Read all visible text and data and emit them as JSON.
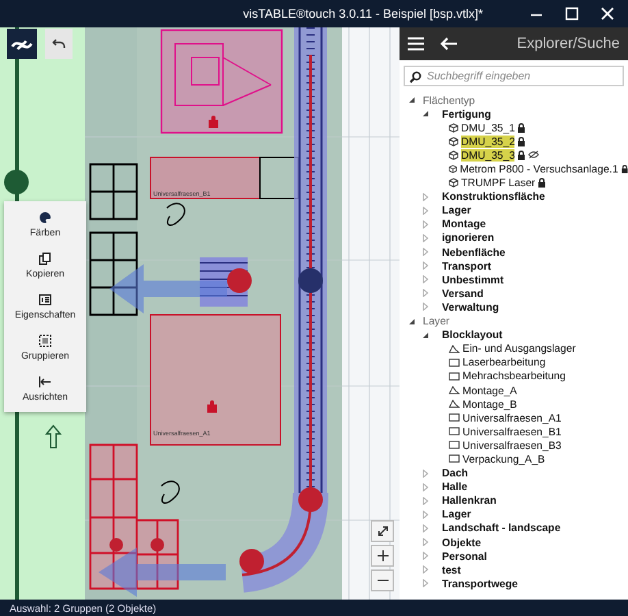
{
  "window": {
    "title": "visTABLE®touch  3.0.11 - Beispiel [bsp.vtlx]*"
  },
  "canvas": {
    "labels": [
      {
        "text": "Universalfraesen_B1"
      },
      {
        "text": "Universalfraesen_A1"
      }
    ]
  },
  "context_menu": {
    "items": [
      {
        "label": "Färben",
        "kind": "palette"
      },
      {
        "label": "Kopieren",
        "kind": "copy"
      },
      {
        "label": "Eigenschaften",
        "kind": "properties"
      },
      {
        "label": "Gruppieren",
        "kind": "group"
      },
      {
        "label": "Ausrichten",
        "kind": "align"
      }
    ]
  },
  "explorer": {
    "title": "Explorer/Suche",
    "search": {
      "placeholder": "Suchbegriff eingeben"
    },
    "tree": [
      {
        "label": "Flächentyp",
        "expanded": true,
        "children": [
          {
            "label": "Fertigung",
            "expanded": true,
            "children": [
              {
                "label": "DMU_35_1",
                "kind": "cube",
                "locked": true,
                "hidden": false,
                "highlighted": false
              },
              {
                "label": "DMU_35_2",
                "kind": "cube",
                "locked": true,
                "hidden": false,
                "highlighted": true
              },
              {
                "label": "DMU_35_3",
                "kind": "cube",
                "locked": true,
                "hidden": true,
                "highlighted": true
              },
              {
                "label": "Metrom P800 - Versuchsanlage.1",
                "kind": "cube",
                "locked": true,
                "hidden": false,
                "highlighted": false
              },
              {
                "label": "TRUMPF Laser",
                "kind": "cube",
                "locked": true,
                "hidden": false,
                "highlighted": false
              }
            ]
          },
          {
            "label": "Konstruktionsfläche",
            "expanded": false
          },
          {
            "label": "Lager",
            "expanded": false
          },
          {
            "label": "Montage",
            "expanded": false
          },
          {
            "label": "ignorieren",
            "expanded": false
          },
          {
            "label": "Nebenfläche",
            "expanded": false
          },
          {
            "label": "Transport",
            "expanded": false
          },
          {
            "label": "Unbestimmt",
            "expanded": false
          },
          {
            "label": "Versand",
            "expanded": false
          },
          {
            "label": "Verwaltung",
            "expanded": false
          }
        ]
      },
      {
        "label": "Layer",
        "expanded": true,
        "children": [
          {
            "label": "Blocklayout",
            "expanded": true,
            "children": [
              {
                "label": "Ein- und Ausgangslager",
                "kind": "poly",
                "locked": false,
                "hidden": false,
                "highlighted": false
              },
              {
                "label": "Laserbearbeitung",
                "kind": "rect",
                "locked": false,
                "hidden": false,
                "highlighted": false
              },
              {
                "label": "Mehrachsbearbeitung",
                "kind": "rect",
                "locked": false,
                "hidden": false,
                "highlighted": false
              },
              {
                "label": "Montage_A",
                "kind": "poly",
                "locked": false,
                "hidden": false,
                "highlighted": false
              },
              {
                "label": "Montage_B",
                "kind": "poly",
                "locked": false,
                "hidden": false,
                "highlighted": false
              },
              {
                "label": "Universalfraesen_A1",
                "kind": "rect",
                "locked": false,
                "hidden": false,
                "highlighted": false
              },
              {
                "label": "Universalfraesen_B1",
                "kind": "rect",
                "locked": false,
                "hidden": false,
                "highlighted": false
              },
              {
                "label": "Universalfraesen_B3",
                "kind": "rect",
                "locked": false,
                "hidden": false,
                "highlighted": false
              },
              {
                "label": "Verpackung_A_B",
                "kind": "rect",
                "locked": false,
                "hidden": false,
                "highlighted": false
              }
            ]
          },
          {
            "label": "Dach",
            "expanded": false
          },
          {
            "label": "Halle",
            "expanded": false
          },
          {
            "label": "Hallenkran",
            "expanded": false
          },
          {
            "label": "Lager",
            "expanded": false
          },
          {
            "label": "Landschaft - landscape",
            "expanded": false
          },
          {
            "label": "Objekte",
            "expanded": false
          },
          {
            "label": "Personal",
            "expanded": false
          },
          {
            "label": "test",
            "expanded": false
          },
          {
            "label": "Transportwege",
            "expanded": false
          }
        ]
      }
    ]
  },
  "status_bar": {
    "text": "Auswahl:  2 Gruppen (2 Objekte)"
  }
}
